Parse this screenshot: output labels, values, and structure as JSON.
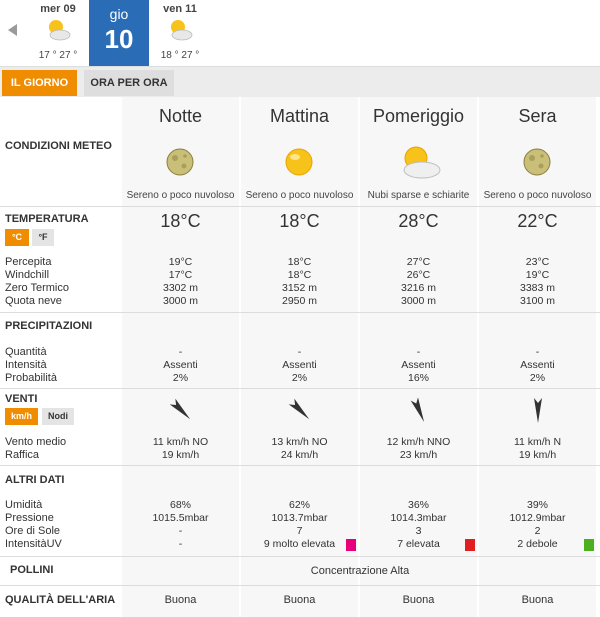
{
  "days": [
    {
      "name": "mer 09",
      "temps": "17 ° 27 °",
      "icon": "sun-cloud-icon"
    },
    {
      "name": "gio",
      "number": "10"
    },
    {
      "name": "ven 11",
      "temps": "18 ° 27 °",
      "icon": "sun-cloud-icon"
    }
  ],
  "tabs": {
    "day": "IL GIORNO",
    "hourly": "ORA PER ORA"
  },
  "labels": {
    "conditions": "CONDIZIONI METEO",
    "temperature": "TEMPERATURA",
    "perceived": "Percepita",
    "windchill": "Windchill",
    "freezing": "Zero Termico",
    "snow": "Quota neve",
    "precip": "PRECIPITAZIONI",
    "quantity": "Quantità",
    "intensity": "Intensità",
    "probability": "Probabilità",
    "wind": "VENTI",
    "wind_avg": "Vento medio",
    "gust": "Raffica",
    "other": "ALTRI DATI",
    "humidity": "Umidità",
    "pressure": "Pressione",
    "sun_hours": "Ore di Sole",
    "uv": "IntensitàUV",
    "pollen": "POLLINI",
    "air": "QUALITÀ DELL'ARIA"
  },
  "units": {
    "celsius": "°C",
    "fahrenheit": "°F",
    "kmh": "km/h",
    "knots": "Nodi"
  },
  "periods": [
    {
      "name": "Notte",
      "icon": "moon-icon",
      "cond": "Sereno o poco nuvoloso",
      "temp": "18°C",
      "perceived": "19°C",
      "windchill": "17°C",
      "freezing": "3302 m",
      "snow": "3000 m",
      "quantity": "-",
      "intensity": "Assenti",
      "probability": "2%",
      "wind": "11 km/h  NO",
      "gust": "19 km/h",
      "wind_deg": 315,
      "humidity": "68%",
      "pressure": "1015.5mbar",
      "sun": "-",
      "uv": "-",
      "uv_color": "",
      "air": "Buona"
    },
    {
      "name": "Mattina",
      "icon": "sun-icon",
      "cond": "Sereno o poco nuvoloso",
      "temp": "18°C",
      "perceived": "18°C",
      "windchill": "18°C",
      "freezing": "3152 m",
      "snow": "2950 m",
      "quantity": "-",
      "intensity": "Assenti",
      "probability": "2%",
      "wind": "13 km/h NO",
      "gust": "24 km/h",
      "wind_deg": 315,
      "humidity": "62%",
      "pressure": "1013.7mbar",
      "sun": "7",
      "uv": "9 molto elevata",
      "uv_color": "#e6007e",
      "air": "Buona"
    },
    {
      "name": "Pomeriggio",
      "icon": "sun-cloud-icon",
      "cond": "Nubi sparse e schiarite",
      "temp": "28°C",
      "perceived": "27°C",
      "windchill": "26°C",
      "freezing": "3216 m",
      "snow": "3000 m",
      "quantity": "-",
      "intensity": "Assenti",
      "probability": "16%",
      "wind": "12 km/h NNO",
      "gust": "23 km/h",
      "wind_deg": 337,
      "humidity": "36%",
      "pressure": "1014.3mbar",
      "sun": "3",
      "uv": "7 elevata",
      "uv_color": "#e02020",
      "air": "Buona"
    },
    {
      "name": "Sera",
      "icon": "moon-icon",
      "cond": "Sereno o poco nuvoloso",
      "temp": "22°C",
      "perceived": "23°C",
      "windchill": "19°C",
      "freezing": "3383 m",
      "snow": "3100 m",
      "quantity": "-",
      "intensity": "Assenti",
      "probability": "2%",
      "wind": "11 km/h N",
      "gust": "19 km/h",
      "wind_deg": 0,
      "humidity": "39%",
      "pressure": "1012.9mbar",
      "sun": "2",
      "uv": "2 debole",
      "uv_color": "#4caf20",
      "air": "Buona"
    }
  ],
  "pollen_value": "Concentrazione Alta"
}
